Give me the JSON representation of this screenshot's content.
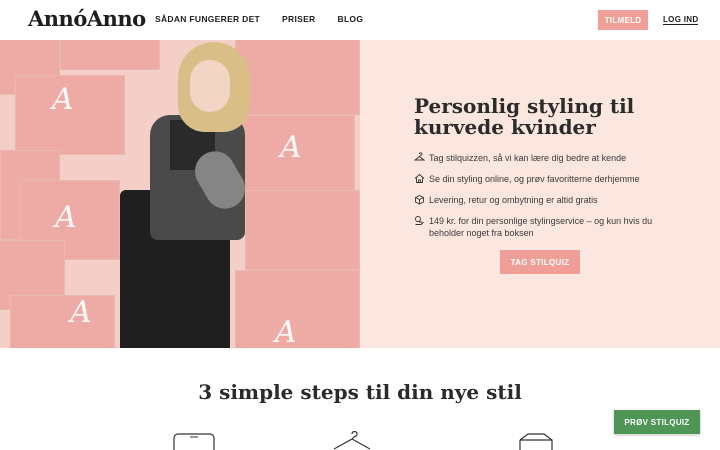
{
  "header": {
    "logo": "AnnóAnno",
    "nav": [
      "SÅDAN FUNGERER DET",
      "PRISER",
      "BLOG"
    ],
    "signup_label": "TILMELD",
    "login_label": "LOG IND"
  },
  "hero": {
    "title": "Personlig styling til kurvede kvinder",
    "features": [
      {
        "icon": "hanger-icon",
        "text": "Tag stilquizzen, så vi kan lære dig bedre at kende"
      },
      {
        "icon": "home-icon",
        "text": "Se din styling online, og prøv favoritterne derhjemme"
      },
      {
        "icon": "box-icon",
        "text": "Levering, retur og ombytning er altid gratis"
      },
      {
        "icon": "price-icon",
        "text": "149 kr. for din personlige stylingservice – og kun hvis du beholder noget fra boksen"
      }
    ],
    "cta_label": "TAG STILQUIZ"
  },
  "steps": {
    "title": "3 simple steps til din nye stil"
  },
  "floating_cta": "PRØV STILQUIZ",
  "colors": {
    "accent_pink": "#ef9f98",
    "hero_bg": "#fce6e0",
    "green": "#4f9656"
  }
}
